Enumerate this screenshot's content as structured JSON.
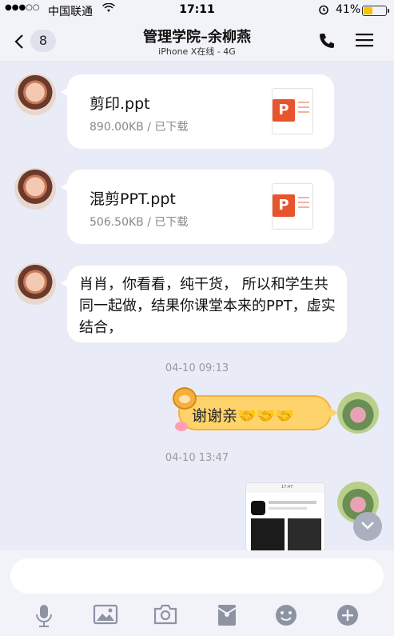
{
  "status": {
    "carrier": "中国联通",
    "time": "17:11",
    "battery_pct": "41%",
    "battery_level": 0.41,
    "battery_color": "#f5c400"
  },
  "header": {
    "back_count": "8",
    "title": "管理学院–余柳燕",
    "subtitle": "iPhone X在线 - 4G"
  },
  "messages": [
    {
      "type": "file",
      "file_name": "剪印.ppt",
      "file_meta": "890.00KB / 已下载",
      "icon": "ppt-file-icon",
      "icon_letter": "P"
    },
    {
      "type": "file",
      "file_name": "混剪PPT.ppt",
      "file_meta": "506.50KB / 已下载",
      "icon": "ppt-file-icon",
      "icon_letter": "P"
    },
    {
      "type": "text",
      "text": "肖肖，你看看，纯干货， 所以和学生共同一起做，结果你课堂本来的PPT，虚实结合，"
    },
    {
      "type": "timestamp",
      "text": "04-10 09:13"
    },
    {
      "type": "sticker-text",
      "text": "谢谢亲🤝🤝🤝"
    },
    {
      "type": "timestamp",
      "text": "04-10 13:47"
    },
    {
      "type": "image",
      "thumb_topbar": "17:47"
    }
  ],
  "input": {
    "placeholder": ""
  },
  "toolbar": [
    "microphone-icon",
    "image-icon",
    "camera-icon",
    "red-packet-icon",
    "emoji-icon",
    "plus-icon"
  ],
  "colors": {
    "accent_ppt": "#e8542c",
    "background": "#e9ecf6",
    "sticker_bubble": "#ffd36b"
  }
}
